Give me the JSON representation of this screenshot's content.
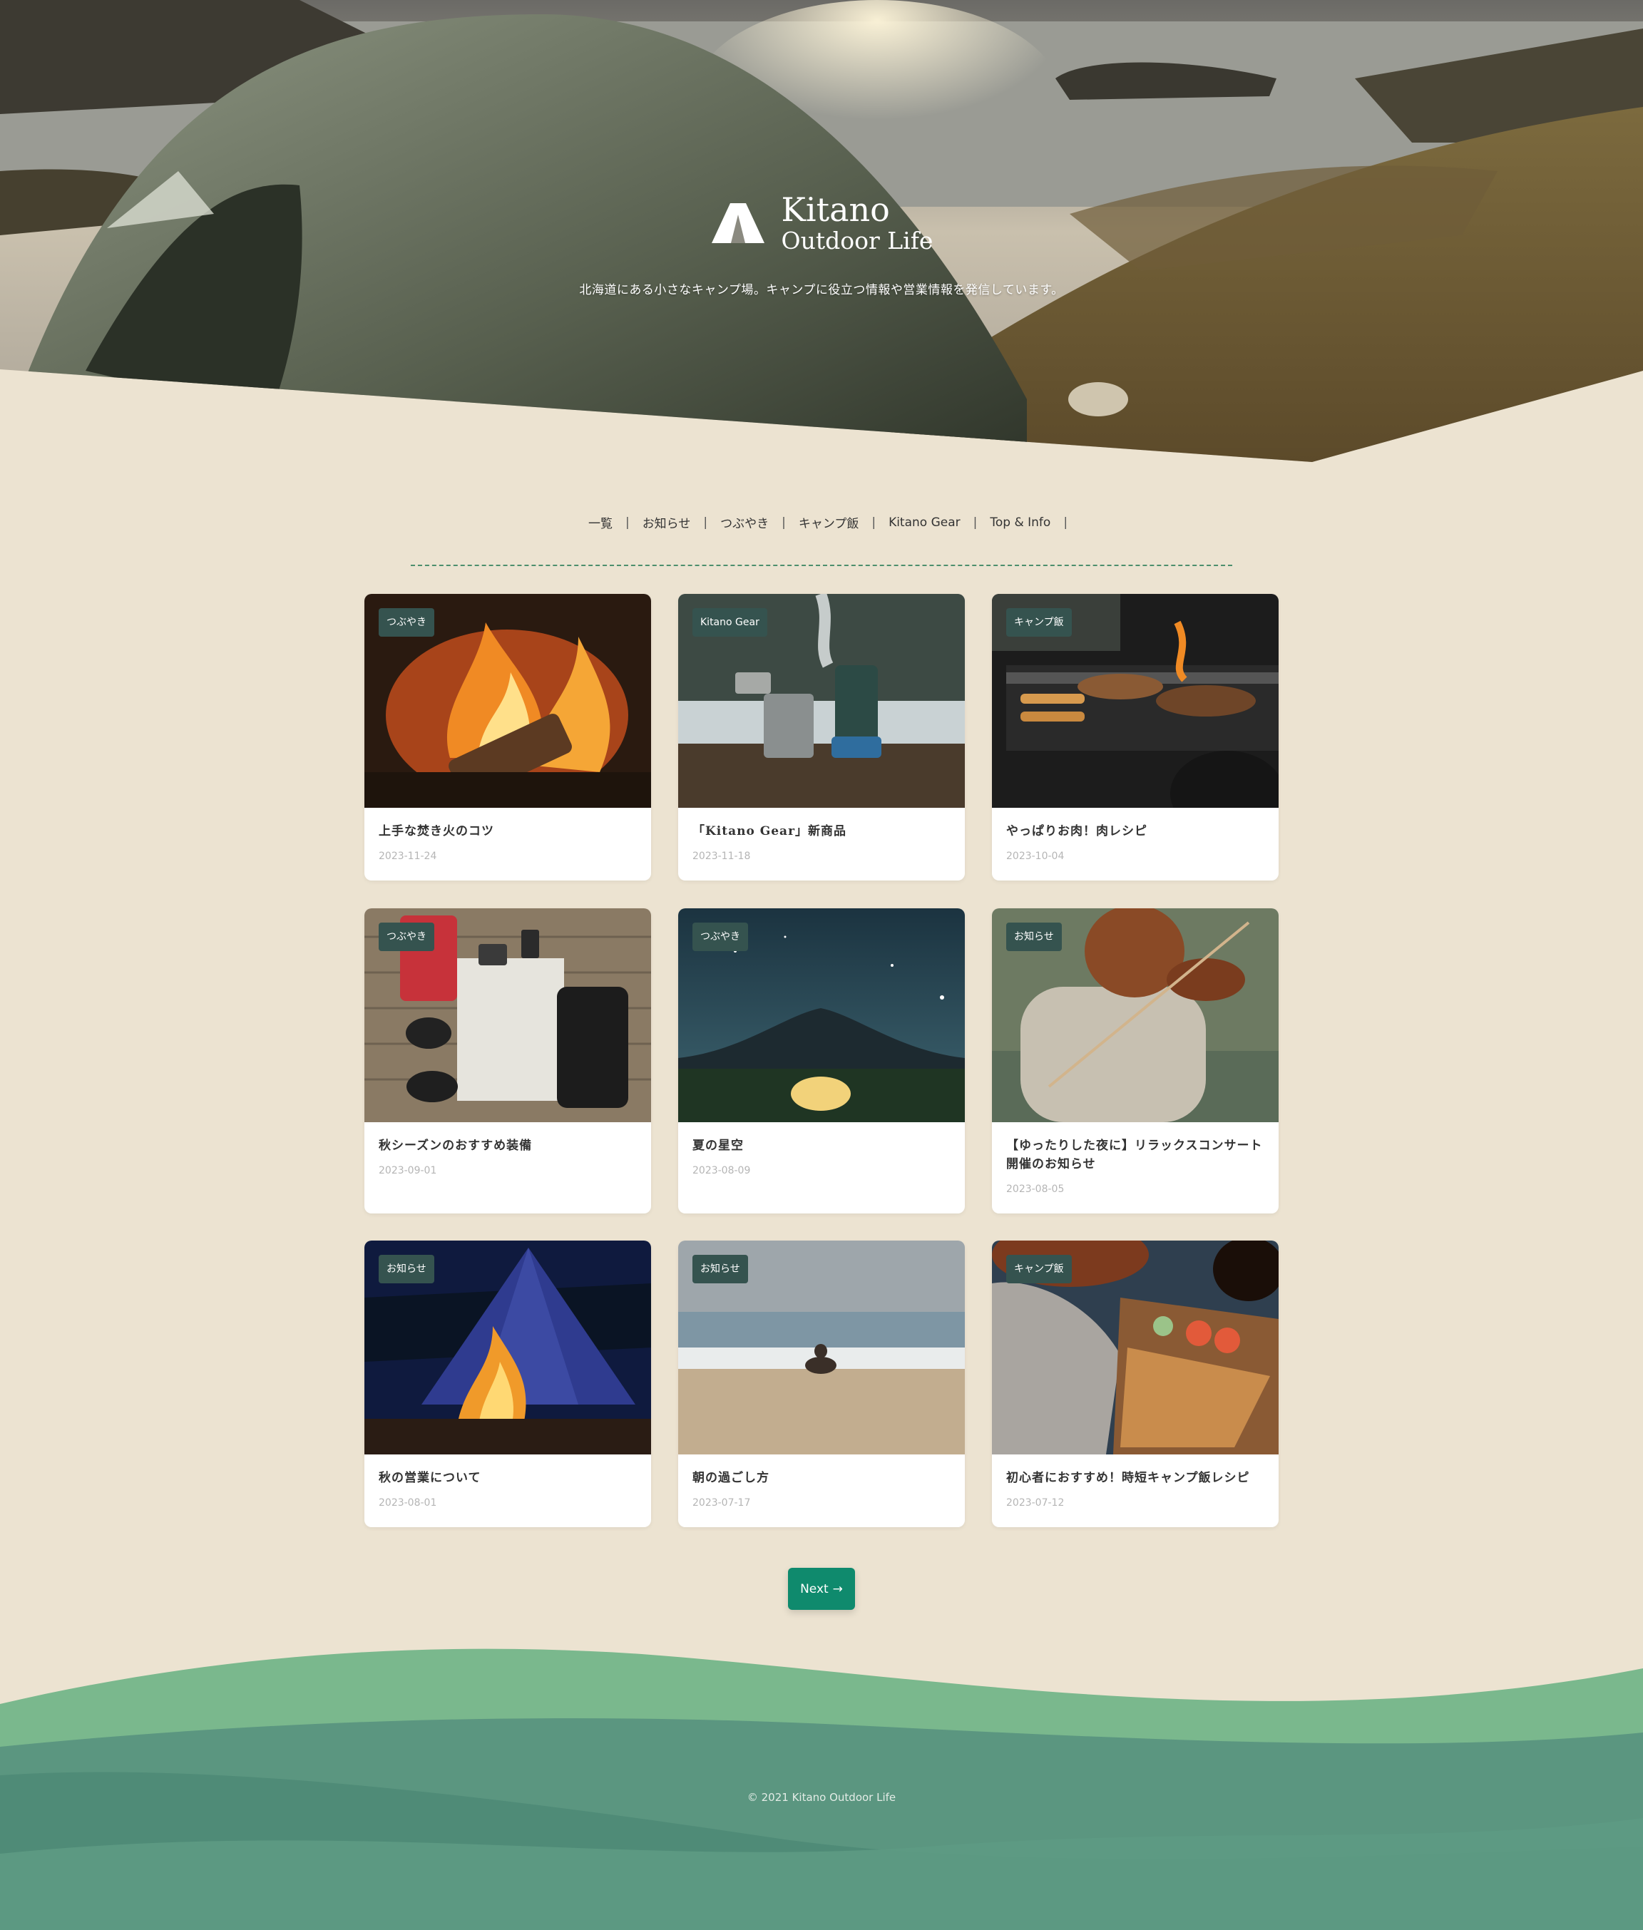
{
  "site": {
    "brand_line1": "Kitano",
    "brand_line2": "Outdoor Life",
    "tagline": "北海道にある小さなキャンプ場。キャンプに役立つ情報や営業情報を発信しています。"
  },
  "nav": {
    "items": [
      "一覧",
      "お知らせ",
      "つぶやき",
      "キャンプ飯",
      "Kitano Gear",
      "Top & Info"
    ],
    "separator": "|"
  },
  "posts": [
    {
      "category": "つぶやき",
      "title": "上手な焚き火のコツ",
      "date": "2023-11-24"
    },
    {
      "category": "Kitano Gear",
      "title": "「Kitano Gear」新商品",
      "date": "2023-11-18"
    },
    {
      "category": "キャンプ飯",
      "title": "やっぱりお肉！肉レシピ",
      "date": "2023-10-04"
    },
    {
      "category": "つぶやき",
      "title": "秋シーズンのおすすめ装備",
      "date": "2023-09-01"
    },
    {
      "category": "つぶやき",
      "title": "夏の星空",
      "date": "2023-08-09"
    },
    {
      "category": "お知らせ",
      "title": "【ゆったりした夜に】リラックスコンサート開催のお知らせ",
      "date": "2023-08-05"
    },
    {
      "category": "お知らせ",
      "title": "秋の営業について",
      "date": "2023-08-01"
    },
    {
      "category": "お知らせ",
      "title": "朝の過ごし方",
      "date": "2023-07-17"
    },
    {
      "category": "キャンプ飯",
      "title": "初心者におすすめ！時短キャンプ飯レシピ",
      "date": "2023-07-12"
    }
  ],
  "pagination": {
    "next_label": "Next",
    "next_arrow": "→"
  },
  "footer": {
    "copyright": "© 2021 Kitano Outdoor Life"
  },
  "colors": {
    "background": "#ece3d1",
    "badge": "#35534f",
    "accent_button": "#0f8a6d",
    "nav_rule": "#4d8f6d",
    "footer_wave_light": "#7ab88d",
    "footer_wave_dark": "#4f8b77"
  }
}
